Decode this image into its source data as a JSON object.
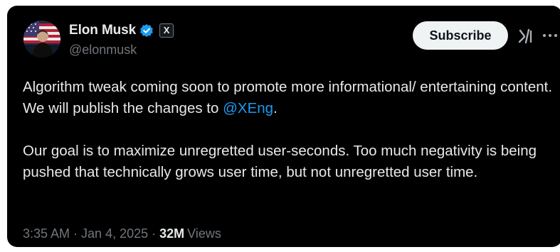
{
  "author": {
    "display_name": "Elon Musk",
    "handle": "@elonmusk",
    "verified": true,
    "affiliation_badge": "X"
  },
  "actions": {
    "subscribe_label": "Subscribe",
    "grok_icon": "grok-icon",
    "more_icon": "more-icon"
  },
  "tweet": {
    "paragraph1_text": "Algorithm tweak coming soon to promote more informational/ entertaining content. We will publish the changes to ",
    "mention": "@XEng",
    "paragraph1_end": ".",
    "paragraph2": "Our goal is to maximize unregretted user-seconds. Too much negativity is being pushed that technically grows user time, but not unregretted user time."
  },
  "meta": {
    "time": "3:35 AM",
    "separator": "·",
    "date": "Jan 4, 2025",
    "views_count": "32M",
    "views_label": "Views"
  },
  "colors": {
    "background": "#000000",
    "text": "#e7e9ea",
    "secondary": "#71767b",
    "accent": "#1d9bf0",
    "verified": "#1d9bf0"
  }
}
